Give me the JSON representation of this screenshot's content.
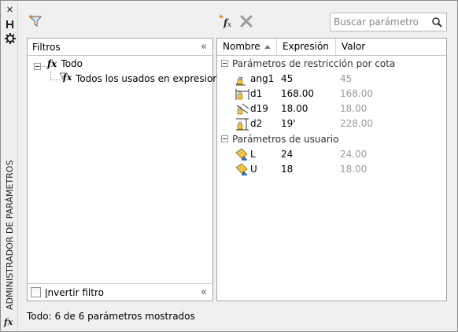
{
  "palette": {
    "accent_orange": "#e08a1e",
    "icon_blue": "#2f6fd1",
    "value_gray": "#9a9a9a"
  },
  "sidebar": {
    "title": "ADMINISTRADOR DE PARÁMETROS",
    "buttons": [
      "close-icon",
      "auto-hide-icon",
      "properties-gear-icon"
    ],
    "bottom_icon": "fx-icon",
    "bottom_icon_glyph": "fx"
  },
  "toolbar": {
    "filter_icon": "funnel-icon",
    "new_param_icon": "new-user-parameter-icon",
    "delete_icon": "delete-x-icon",
    "search": {
      "placeholder": "Buscar parámetro",
      "value": ""
    }
  },
  "filters_panel": {
    "title": "Filtros",
    "tree": [
      {
        "glyph": "fx",
        "label": "Todo",
        "icon": "fx-icon"
      },
      {
        "glyph": "fx",
        "label": "Todos los usados en expresiones",
        "icon": "filtered-fx-icon"
      }
    ],
    "invert_label_first": "I",
    "invert_label_rest": "nvertir filtro",
    "invert_checked": false
  },
  "grid": {
    "columns": [
      "Nombre",
      "Expresión",
      "Valor"
    ],
    "sorted_column": "Nombre",
    "sort_direction": "ascending",
    "groups": [
      {
        "label": "Parámetros de restricción por cota",
        "rows": [
          {
            "name": "ang1",
            "expression": "45",
            "value": "45",
            "icon": "angular-dimension-icon"
          },
          {
            "name": "d1",
            "expression": "168.00",
            "value": "168.00",
            "icon": "horizontal-dimension-icon"
          },
          {
            "name": "d19",
            "expression": "18.00",
            "value": "18.00",
            "icon": "aligned-dimension-icon"
          },
          {
            "name": "d2",
            "expression": "19'",
            "value": "228.00",
            "icon": "vertical-dimension-icon"
          }
        ]
      },
      {
        "label": "Parámetros de usuario",
        "rows": [
          {
            "name": "L",
            "expression": "24",
            "value": "24.00",
            "icon": "user-parameter-icon"
          },
          {
            "name": "U",
            "expression": "18",
            "value": "18.00",
            "icon": "user-parameter-icon"
          }
        ]
      }
    ]
  },
  "status": {
    "text": "Todo: 6 de 6 parámetros mostrados"
  }
}
